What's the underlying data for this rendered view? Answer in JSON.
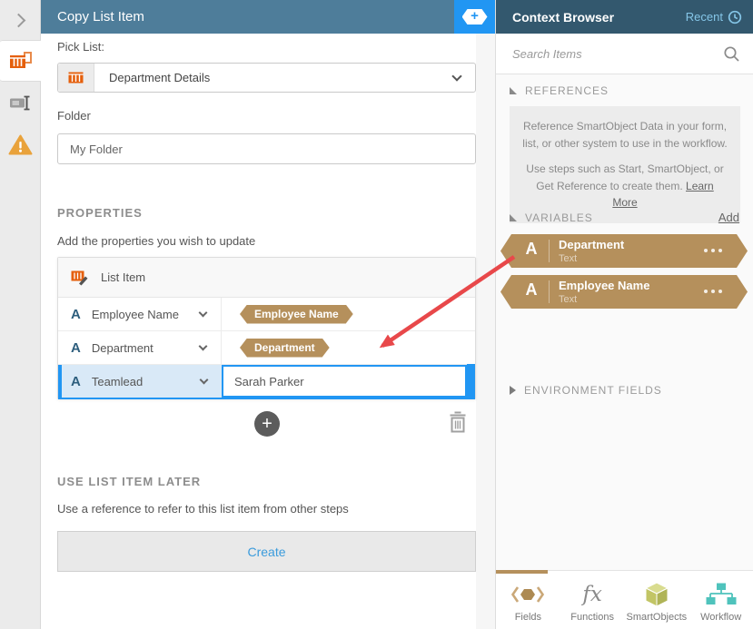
{
  "colors": {
    "accent_blue": "#2196f3",
    "main_header_bg": "#4e7d9a",
    "context_header_bg": "#33586e",
    "tag_tan": "#b5905c",
    "icon_orange": "#e55f0c",
    "warning_orange": "#e9a23b",
    "recent_link_blue": "#85c6e8",
    "create_link_blue": "#3a9bdc",
    "selected_row_bg": "#d9e9f7",
    "arrow_red": "#e8484a",
    "smartobjects_olive": "#c2c565",
    "workflow_teal": "#4fc3bc"
  },
  "icons": {
    "plus": "+",
    "fx": "fx"
  },
  "main_panel": {
    "title": "Copy List Item",
    "pick_list": {
      "label": "Pick List:",
      "value": "Department Details"
    },
    "folder": {
      "label": "Folder",
      "value": "My Folder"
    },
    "properties": {
      "heading": "PROPERTIES",
      "description": "Add the properties you wish to update",
      "list_title": "List Item",
      "rows": [
        {
          "name": "Employee Name",
          "value_tag": "Employee Name"
        },
        {
          "name": "Department",
          "value_tag": "Department"
        },
        {
          "name": "Teamlead",
          "value_text": "Sarah Parker"
        }
      ]
    },
    "use_later": {
      "heading": "USE LIST ITEM LATER",
      "description": "Use a reference to refer to this list item from other steps",
      "create_label": "Create"
    }
  },
  "context_browser": {
    "title": "Context Browser",
    "recent_label": "Recent",
    "search_placeholder": "Search Items",
    "references": {
      "heading": "REFERENCES",
      "info_line1": "Reference SmartObject Data in your form, list, or other system to use in the workflow.",
      "info_line2": "Use steps such as Start, SmartObject, or Get Reference to create them.",
      "learn_more_label": "Learn More"
    },
    "variables": {
      "heading": "VARIABLES",
      "add_label": "Add",
      "items": [
        {
          "name": "Department",
          "type": "Text"
        },
        {
          "name": "Employee Name",
          "type": "Text"
        }
      ]
    },
    "environment_fields_heading": "ENVIRONMENT FIELDS",
    "tabs": [
      {
        "label": "Fields"
      },
      {
        "label": "Functions"
      },
      {
        "label": "SmartObjects"
      },
      {
        "label": "Workflow"
      }
    ]
  }
}
